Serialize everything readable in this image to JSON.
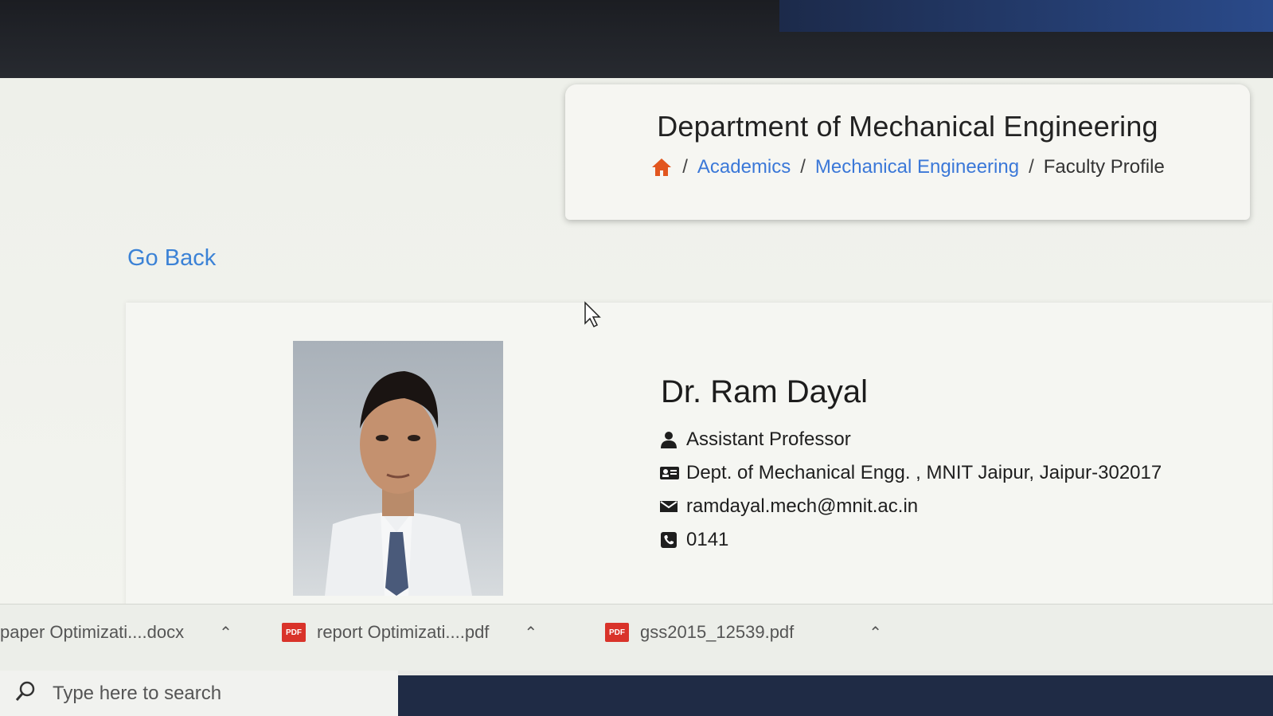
{
  "header": {
    "title": "Department of Mechanical Engineering",
    "breadcrumb": {
      "home_icon": "home-icon",
      "items": [
        "Academics",
        "Mechanical Engineering",
        "Faculty Profile"
      ],
      "separator": "/"
    }
  },
  "go_back": "Go Back",
  "profile": {
    "name": "Dr. Ram Dayal",
    "designation": "Assistant Professor",
    "address": "Dept. of Mechanical Engg. , MNIT Jaipur, Jaipur-302017",
    "email": "ramdayal.mech@mnit.ac.in",
    "phone": "0141",
    "accent_color": "#e8a623"
  },
  "downloads": [
    {
      "name": "paper  Optimizati....docx",
      "type": "docx"
    },
    {
      "name": "report  Optimizati....pdf",
      "type": "pdf"
    },
    {
      "name": "gss2015_12539.pdf",
      "type": "pdf"
    }
  ],
  "taskbar": {
    "search_placeholder": "Type here to search"
  }
}
